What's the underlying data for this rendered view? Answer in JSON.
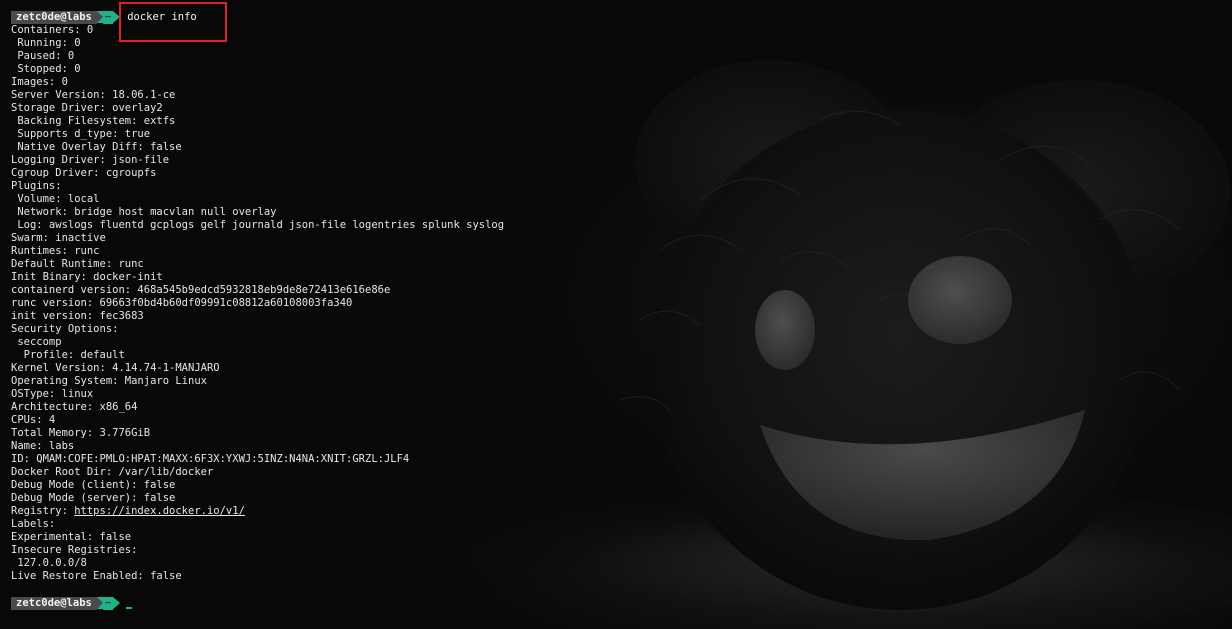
{
  "prompt": {
    "user_host": "zetc0de@labs",
    "dir": "~",
    "command": "docker info"
  },
  "output": {
    "containers": "Containers: 0",
    "running": " Running: 0",
    "paused": " Paused: 0",
    "stopped": " Stopped: 0",
    "images": "Images: 0",
    "server_version": "Server Version: 18.06.1-ce",
    "storage_driver": "Storage Driver: overlay2",
    "backing_fs": " Backing Filesystem: extfs",
    "supports_dtype": " Supports d_type: true",
    "native_overlay": " Native Overlay Diff: false",
    "logging_driver": "Logging Driver: json-file",
    "cgroup_driver": "Cgroup Driver: cgroupfs",
    "plugins": "Plugins:",
    "volume": " Volume: local",
    "network": " Network: bridge host macvlan null overlay",
    "log": " Log: awslogs fluentd gcplogs gelf journald json-file logentries splunk syslog",
    "swarm": "Swarm: inactive",
    "runtimes": "Runtimes: runc",
    "default_runtime": "Default Runtime: runc",
    "init_binary": "Init Binary: docker-init",
    "containerd_version": "containerd version: 468a545b9edcd5932818eb9de8e72413e616e86e",
    "runc_version": "runc version: 69663f0bd4b60df09991c08812a60108003fa340",
    "init_version": "init version: fec3683",
    "security_options": "Security Options:",
    "seccomp": " seccomp",
    "profile": "  Profile: default",
    "kernel_version": "Kernel Version: 4.14.74-1-MANJARO",
    "operating_system": "Operating System: Manjaro Linux",
    "ostype": "OSType: linux",
    "architecture": "Architecture: x86_64",
    "cpus": "CPUs: 4",
    "total_memory": "Total Memory: 3.776GiB",
    "name": "Name: labs",
    "id": "ID: QMAM:COFE:PMLO:HPAT:MAXX:6F3X:YXWJ:5INZ:N4NA:XNIT:GRZL:JLF4",
    "docker_root_dir": "Docker Root Dir: /var/lib/docker",
    "debug_client": "Debug Mode (client): false",
    "debug_server": "Debug Mode (server): false",
    "registry_label": "Registry: ",
    "registry_url": "https://index.docker.io/v1/",
    "labels": "Labels:",
    "experimental": "Experimental: false",
    "insecure_registries": "Insecure Registries:",
    "insecure_ip": " 127.0.0.0/8",
    "live_restore": "Live Restore Enabled: false"
  },
  "colors": {
    "background": "#080808",
    "text": "#e6e6e6",
    "prompt_user_bg": "#4a4a4a",
    "prompt_dir_bg": "#1fb28a",
    "highlight": "#e0202a"
  },
  "icons": {
    "wallpaper": "deadmau5-mouse-head-icon"
  }
}
